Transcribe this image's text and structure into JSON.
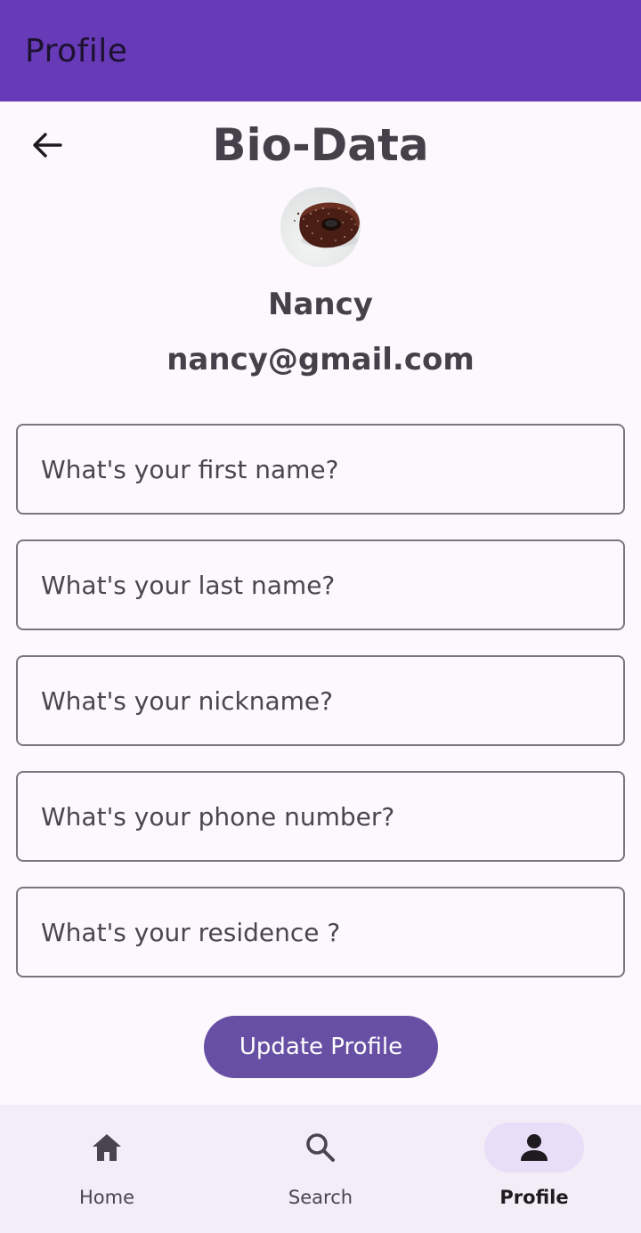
{
  "app_bar": {
    "title": "Profile"
  },
  "header": {
    "title": "Bio-Data"
  },
  "user": {
    "name": "Nancy",
    "email": "nancy@gmail.com"
  },
  "form": {
    "fields": [
      {
        "placeholder": "What's your first name?",
        "value": ""
      },
      {
        "placeholder": "What's your last name?",
        "value": ""
      },
      {
        "placeholder": "What's your nickname?",
        "value": ""
      },
      {
        "placeholder": "What's your phone number?",
        "value": ""
      },
      {
        "placeholder": "What's your residence ?",
        "value": ""
      }
    ],
    "submit_label": "Update Profile"
  },
  "bottom_nav": {
    "items": [
      {
        "label": "Home",
        "icon": "home-icon"
      },
      {
        "label": "Search",
        "icon": "search-icon"
      },
      {
        "label": "Profile",
        "icon": "person-icon",
        "active": true
      }
    ]
  },
  "colors": {
    "app_bar": "#673ab7",
    "primary_button": "#6750a4",
    "nav_background": "#f2edf6",
    "nav_active_pill": "#e8def8",
    "text": "#44414a"
  }
}
